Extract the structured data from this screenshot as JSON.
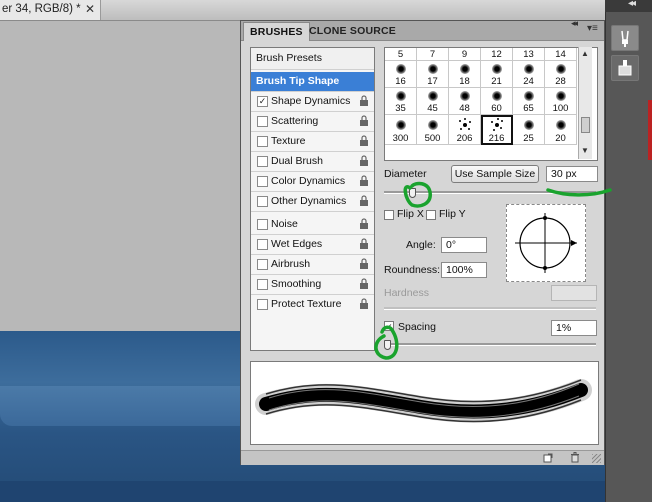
{
  "document": {
    "tab_title": "er 34, RGB/8) *",
    "close_glyph": "✕"
  },
  "dock": {
    "collapse_glyph": "◂◂",
    "tool_icon_1": "brush-presets-icon",
    "tool_icon_2": "clone-source-icon"
  },
  "panel": {
    "tabs": [
      "BRUSHES",
      "CLONE SOURCE"
    ],
    "collapse_glyph": "◂◂",
    "menu_glyph": "▾≡",
    "sections": [
      {
        "label": "Brush Presets",
        "checked": null,
        "lock": false
      },
      {
        "label": "Brush Tip Shape",
        "checked": null,
        "lock": false,
        "selected": true
      },
      {
        "label": "Shape Dynamics",
        "checked": true,
        "lock": true
      },
      {
        "label": "Scattering",
        "checked": false,
        "lock": true
      },
      {
        "label": "Texture",
        "checked": false,
        "lock": true
      },
      {
        "label": "Dual Brush",
        "checked": false,
        "lock": true
      },
      {
        "label": "Color Dynamics",
        "checked": false,
        "lock": true
      },
      {
        "label": "Other Dynamics",
        "checked": false,
        "lock": true
      },
      {
        "label": "Noise",
        "checked": false,
        "lock": true
      },
      {
        "label": "Wet Edges",
        "checked": false,
        "lock": true
      },
      {
        "label": "Airbrush",
        "checked": false,
        "lock": true
      },
      {
        "label": "Smoothing",
        "checked": false,
        "lock": true
      },
      {
        "label": "Protect Texture",
        "checked": false,
        "lock": true
      }
    ],
    "preset_grid": {
      "top_row": [
        "5",
        "7",
        "9",
        "12",
        "13",
        "14"
      ],
      "row2": [
        "16",
        "17",
        "18",
        "21",
        "24",
        "28"
      ],
      "row3": [
        "35",
        "45",
        "48",
        "60",
        "65",
        "100"
      ],
      "row4": [
        "300",
        "500",
        "206",
        "216",
        "25",
        "20"
      ],
      "selected": "216"
    },
    "diameter": {
      "label": "Diameter",
      "use_sample_label": "Use Sample Size",
      "value": "30 px",
      "slider_fraction": 0.12
    },
    "flip_x": {
      "label": "Flip X",
      "checked": false
    },
    "flip_y": {
      "label": "Flip Y",
      "checked": false
    },
    "angle": {
      "label": "Angle:",
      "value": "0°"
    },
    "roundness": {
      "label": "Roundness:",
      "value": "100%"
    },
    "hardness": {
      "label": "Hardness",
      "value": ""
    },
    "spacing": {
      "label": "Spacing",
      "checked": true,
      "value": "1%",
      "slider_fraction": 0.0
    },
    "check_glyph": "✓",
    "footer_icons": [
      "new-preset-icon",
      "trash-icon"
    ]
  },
  "colors": {
    "selected_row": "#3a7fd6",
    "annotation_green": "#1aa32e",
    "canvas_blue": "#2c5a8b"
  }
}
